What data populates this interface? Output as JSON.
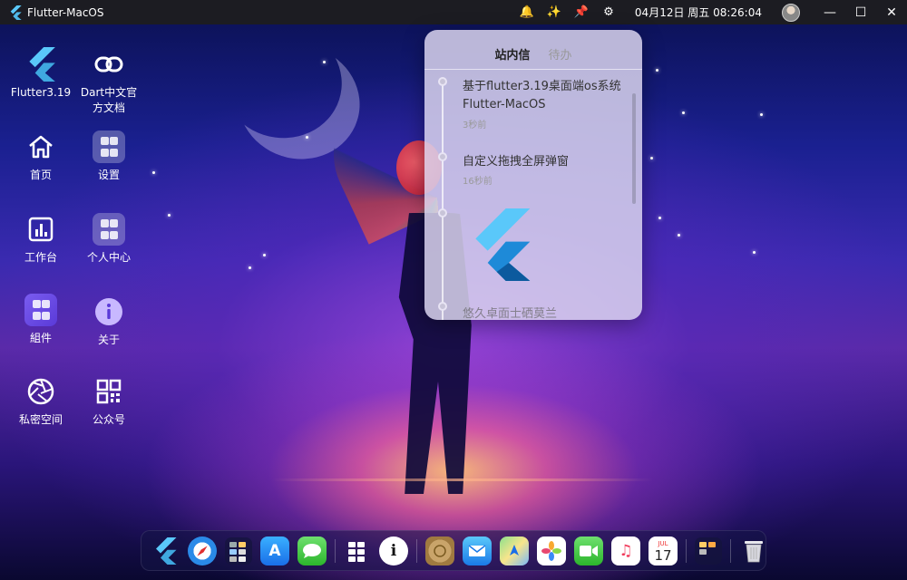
{
  "window": {
    "title": "Flutter-MacOS"
  },
  "topbar": {
    "datetime": "04月12日 周五 08:26:04",
    "icons": [
      "bell-icon",
      "magic-wand-icon",
      "pin-icon",
      "gear-icon"
    ],
    "minimize": "—",
    "maximize": "☐",
    "close": "✕"
  },
  "desktop": {
    "flutter": "Flutter3.19",
    "dart_docs": "Dart中文官方文档",
    "home": "首页",
    "settings": "设置",
    "workbench": "工作台",
    "personal_center": "个人中心",
    "widgets": "組件",
    "about": "关于",
    "private_space": "私密空间",
    "official_account": "公众号"
  },
  "panel": {
    "tabs": [
      "站内信",
      "待办"
    ],
    "items": [
      {
        "title": "基于flutter3.19桌面端os系统Flutter-MacOS",
        "time": "3秒前"
      },
      {
        "title": "自定义拖拽全屏弹窗",
        "time": "16秒前"
      }
    ],
    "partial_text": "悠久卓面士硒莫兰"
  },
  "dock": {
    "apps": [
      "flutter-icon",
      "safari-icon",
      "widgets-icon",
      "app-store-icon",
      "messages-icon",
      "settings-grid-icon",
      "info-icon",
      "coin-icon",
      "mail-icon",
      "maps-icon",
      "photos-icon",
      "facetime-icon",
      "music-icon",
      "calendar-icon",
      "folder-icon",
      "trash-icon"
    ],
    "calendar_month": "JUL",
    "calendar_day": "17"
  },
  "colors": {
    "accent": "#5ac8fa",
    "topbar": "#1c1c22"
  }
}
